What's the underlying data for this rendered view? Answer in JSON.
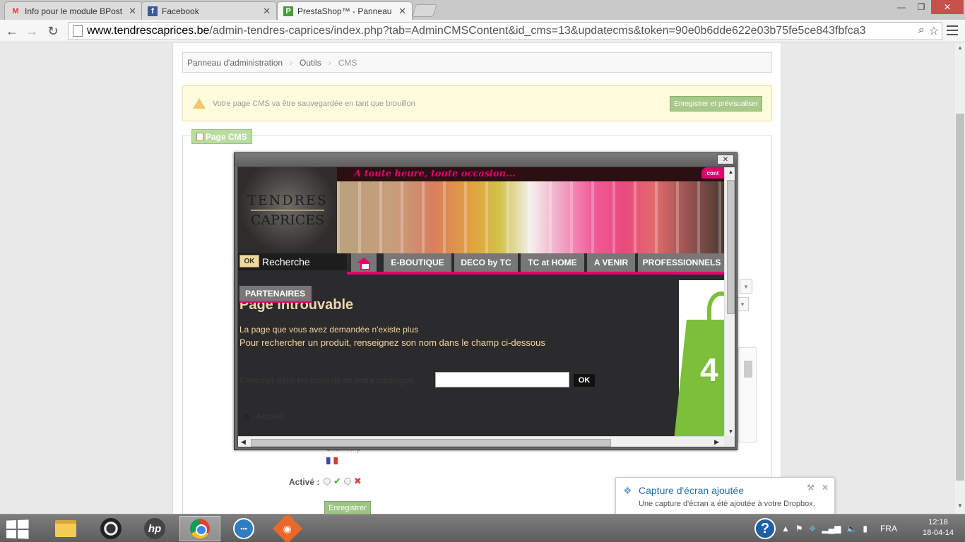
{
  "browser": {
    "tabs": [
      {
        "label": "Info pour le module BPost",
        "favicon": "gmail-icon",
        "active": false
      },
      {
        "label": "Facebook",
        "favicon": "facebook-icon",
        "active": false
      },
      {
        "label": "PrestaShop™ - Panneau d'",
        "favicon": "prestashop-icon",
        "active": true
      }
    ],
    "url_host": "www.tendrescaprices.be",
    "url_path": "/admin-tendres-caprices/index.php?tab=AdminCMSContent&id_cms=13&updatecms&token=90e0b6dde622e03b75fe5ce843fbfca3"
  },
  "admin": {
    "breadcrumb": [
      "Panneau d'administration",
      "Outils",
      "CMS"
    ],
    "warning_text": "Votre page CMS va être sauvegardée en tant que brouillon",
    "preview_button": "Enregistrer et prévisualiser",
    "legend": "Page CMS",
    "chemin_label": "Chemin: p",
    "active_label": "Activé :",
    "save_button": "Enregistrer"
  },
  "popup": {
    "close_label": "✕",
    "site": {
      "logo_line1": "TENDRES",
      "logo_line2": "CAPRICES",
      "slogan": "A toute heure, toute occasion...",
      "contact_tab": "cont",
      "search_ok": "OK",
      "search_text": "Recherche",
      "nav": [
        "E-BOUTIQUE",
        "DECO by TC",
        "TC at HOME",
        "A VENIR",
        "PROFESSIONNELS"
      ],
      "partenaires": "PARTENAIRES",
      "title": "Page introuvable",
      "msg1": "La page que vous avez demandée n'existe plus",
      "msg2": "Pour rechercher un produit, renseignez son nom dans le champ ci-dessous",
      "search_label": "Chercher dans les produits de notre catalogue :",
      "search_button": "OK",
      "home_link": "Accueil",
      "promo_digit": "4"
    }
  },
  "toast": {
    "title": "Capture d'écran ajoutée",
    "body": "Une capture d'écran a été ajoutée à votre Dropbox."
  },
  "taskbar": {
    "lang": "FRA",
    "time": "12:18",
    "date": "18-04-14"
  },
  "colors": {
    "brand_pink": "#e5006c",
    "admin_green": "#9dc385"
  }
}
